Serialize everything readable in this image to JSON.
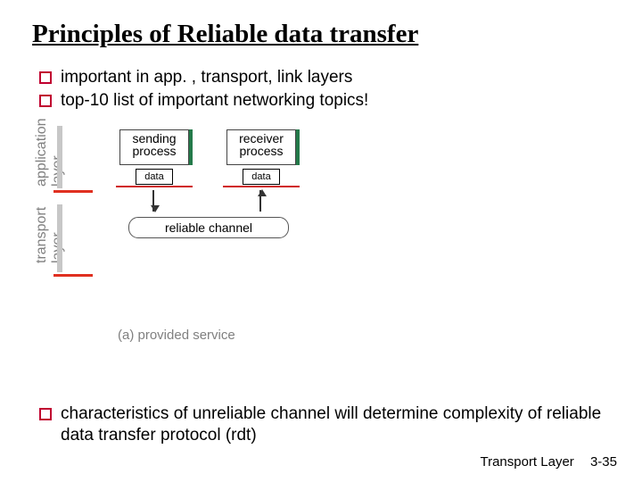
{
  "title": "Principles of Reliable data transfer",
  "bullets": [
    "important in app. , transport, link layers",
    "top-10 list of important networking topics!"
  ],
  "diagram": {
    "layers": {
      "application": "application\nlayer",
      "transport": "transport\nlayer"
    },
    "sending_process": "sending\nprocess",
    "receiver_process": "receiver\nprocess",
    "data_label": "data",
    "channel": "reliable channel",
    "caption": "(a)  provided service"
  },
  "bottom_bullet": "characteristics of unreliable channel will determine complexity of reliable data transfer protocol (rdt)",
  "footer": {
    "chapter": "Transport Layer",
    "page": "3-35"
  }
}
